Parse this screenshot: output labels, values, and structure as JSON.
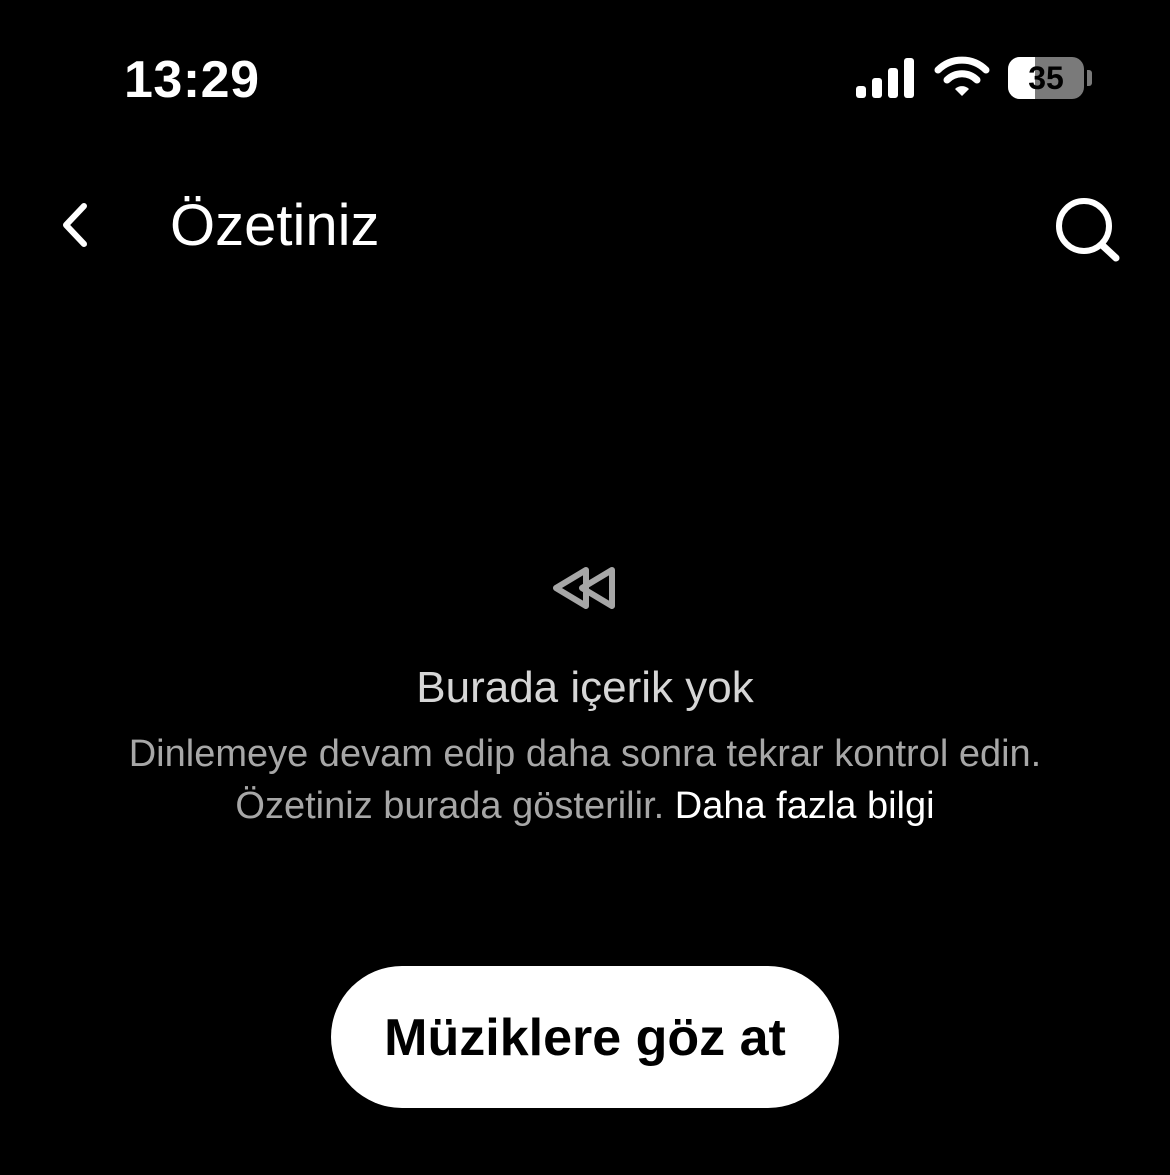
{
  "status_bar": {
    "time": "13:29",
    "battery_level": "35",
    "battery_fraction": 0.35,
    "icons": [
      "signal-icon",
      "wifi-icon",
      "battery-icon"
    ]
  },
  "header": {
    "title": "Özetiniz",
    "back_icon": "chevron-left-icon",
    "search_icon": "search-icon"
  },
  "empty_state": {
    "icon": "rewind-icon",
    "title": "Burada içerik yok",
    "description_line1": "Dinlemeye devam edip daha sonra tekrar kontrol edin.",
    "description_line2": "Özetiniz burada gösterilir.",
    "learn_more": "Daha fazla bilgi"
  },
  "primary_action": {
    "label": "Müziklere göz at"
  },
  "colors": {
    "background": "#000000",
    "text_primary": "#ffffff",
    "text_secondary": "#a7a7a7",
    "button_bg": "#ffffff",
    "button_text": "#000000"
  }
}
